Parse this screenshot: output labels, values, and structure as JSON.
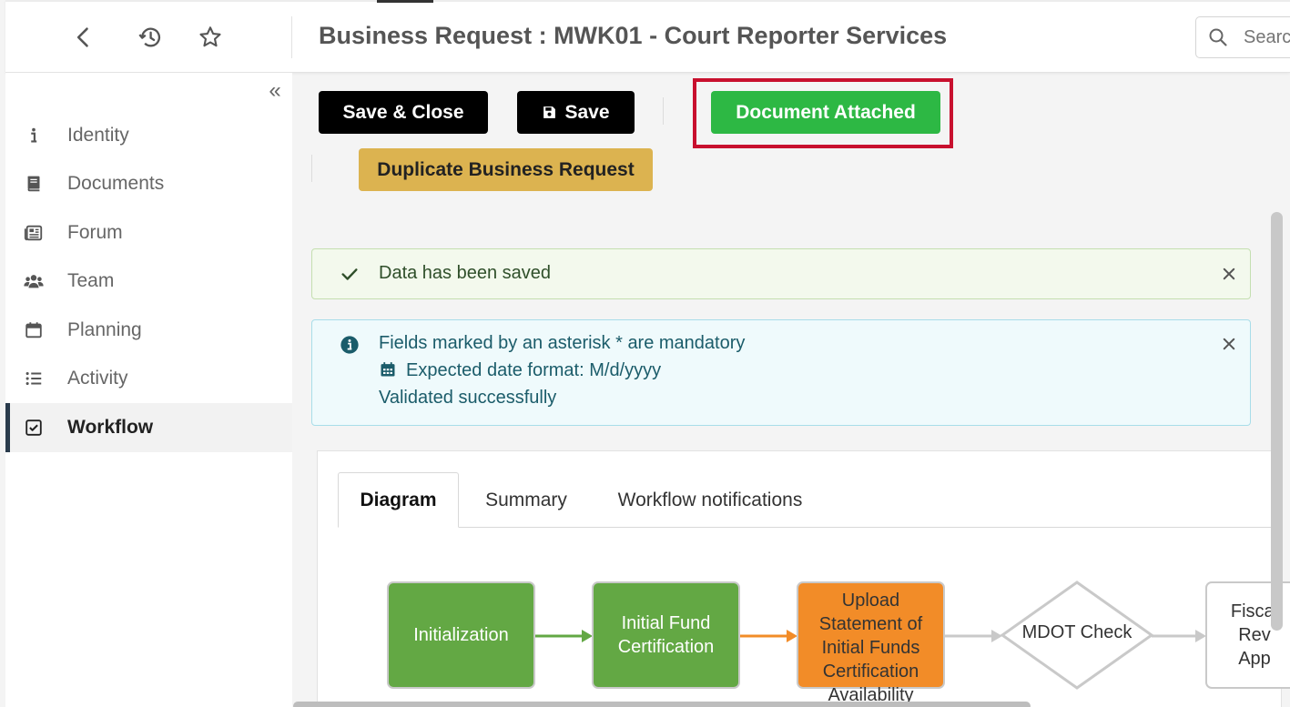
{
  "header": {
    "title": "Business Request : MWK01 - Court Reporter Services",
    "back_icon": "chevron-left-icon",
    "history_icon": "history-icon",
    "favorite_icon": "star-icon",
    "search_placeholder": "Search"
  },
  "sidebar": {
    "collapse_label": "«",
    "items": [
      {
        "label": "Identity",
        "icon": "info-icon"
      },
      {
        "label": "Documents",
        "icon": "book-icon"
      },
      {
        "label": "Forum",
        "icon": "newspaper-icon"
      },
      {
        "label": "Team",
        "icon": "users-icon"
      },
      {
        "label": "Planning",
        "icon": "calendar-icon"
      },
      {
        "label": "Activity",
        "icon": "list-icon"
      },
      {
        "label": "Workflow",
        "icon": "checkbox-icon",
        "active": true
      }
    ]
  },
  "toolbar": {
    "save_close_label": "Save & Close",
    "save_label": "Save",
    "document_attached_label": "Document Attached",
    "duplicate_label": "Duplicate Business Request"
  },
  "alerts": {
    "success": {
      "text": "Data has been saved"
    },
    "info": {
      "line1": "Fields marked by an asterisk * are mandatory",
      "line2": "Expected date format: M/d/yyyy",
      "line3": "Validated successfully"
    }
  },
  "tabs": [
    {
      "label": "Diagram",
      "active": true
    },
    {
      "label": "Summary"
    },
    {
      "label": "Workflow notifications"
    }
  ],
  "diagram": {
    "nodes": [
      {
        "label": "Initialization",
        "status": "completed"
      },
      {
        "label_lines": [
          "Initial Fund",
          "Certification"
        ],
        "status": "completed"
      },
      {
        "label_lines": [
          "Upload",
          "Statement of",
          "Initial Funds",
          "Certification",
          "Availability"
        ],
        "status": "current"
      },
      {
        "label": "MDOT Check",
        "shape": "decision"
      },
      {
        "label_lines": [
          "Fiscal",
          "Rev",
          "App"
        ],
        "status": "pending"
      }
    ]
  },
  "colors": {
    "completed": "#63a844",
    "current": "#f28c28",
    "pending": "#ffffff",
    "document_attached": "#2db844",
    "duplicate": "#dcb350",
    "highlight": "#c8102e"
  }
}
